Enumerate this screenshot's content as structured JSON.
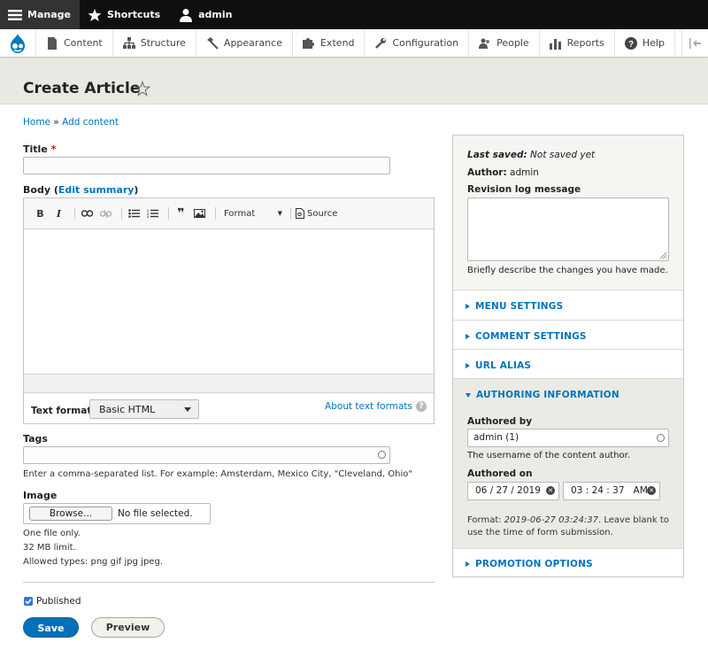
{
  "toolbar": {
    "manage": "Manage",
    "shortcuts": "Shortcuts",
    "user": "admin"
  },
  "admin_menu": [
    {
      "label": "Content",
      "icon": "content-icon"
    },
    {
      "label": "Structure",
      "icon": "structure-icon"
    },
    {
      "label": "Appearance",
      "icon": "appearance-icon"
    },
    {
      "label": "Extend",
      "icon": "extend-icon"
    },
    {
      "label": "Configuration",
      "icon": "configuration-icon"
    },
    {
      "label": "People",
      "icon": "people-icon"
    },
    {
      "label": "Reports",
      "icon": "reports-icon"
    },
    {
      "label": "Help",
      "icon": "help-icon"
    }
  ],
  "page": {
    "title": "Create Article",
    "breadcrumb_home": "Home",
    "breadcrumb_sep": " » ",
    "breadcrumb_add": "Add content"
  },
  "form": {
    "title_label": "Title",
    "title_required": "*",
    "body_label": "Body (",
    "body_edit_summary": "Edit summary",
    "body_label_end": ")",
    "editor": {
      "bold": "B",
      "italic": "I",
      "quote": "❞",
      "format": "Format",
      "source": "Source"
    },
    "text_format_label": "Text format",
    "text_format_value": "Basic HTML",
    "about_formats": "About text formats",
    "tags_label": "Tags",
    "tags_desc": "Enter a comma-separated list. For example: Amsterdam, Mexico City, \"Cleveland, Ohio\"",
    "image_label": "Image",
    "browse": "Browse...",
    "no_file": "No file selected.",
    "image_desc_1": "One file only.",
    "image_desc_2": "32 MB limit.",
    "image_desc_3": "Allowed types: png gif jpg jpeg.",
    "published": "Published",
    "save": "Save",
    "preview": "Preview"
  },
  "sidebar": {
    "last_saved_label": "Last saved:",
    "last_saved_value": " Not saved yet",
    "author_label": "Author:",
    "author_value": " admin",
    "revision_label": "Revision log message",
    "revision_desc": "Briefly describe the changes you have made.",
    "menu_settings": "MENU SETTINGS",
    "comment_settings": "COMMENT SETTINGS",
    "url_alias": "URL ALIAS",
    "authoring_info": "AUTHORING INFORMATION",
    "authored_by_label": "Authored by",
    "authored_by_value": "admin (1)",
    "authored_by_desc": "The username of the content author.",
    "authored_on_label": "Authored on",
    "date_value": "06 / 27 / 2019",
    "time_value": "03 : 24 : 37   AM",
    "format_prefix": "Format: ",
    "format_example": "2019-06-27 03:24:37",
    "format_suffix": ". Leave blank to",
    "format_line2": "use the time of form submission.",
    "promotion": "PROMOTION OPTIONS"
  },
  "colors": {
    "link": "#0074bd",
    "primary_button": "#0071b8",
    "toolbar_bg": "#0f0f0f"
  }
}
